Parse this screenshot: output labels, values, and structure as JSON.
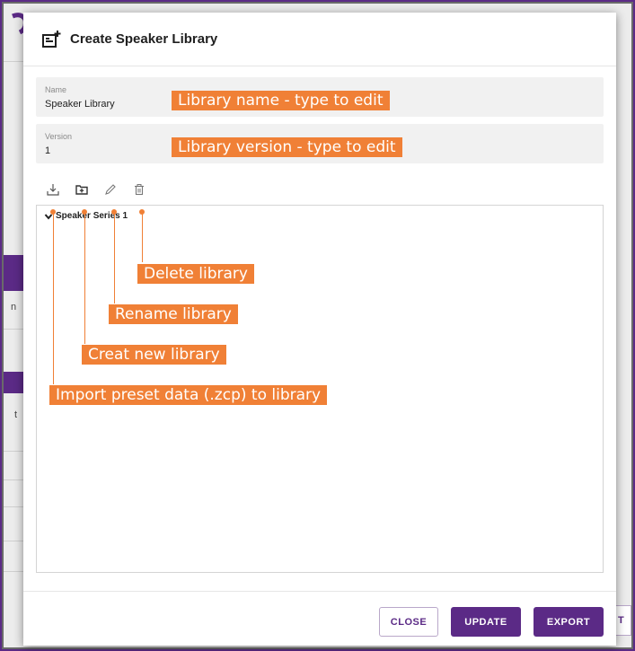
{
  "modal": {
    "title": "Create Speaker Library",
    "icon": "add-library-icon"
  },
  "fields": {
    "name": {
      "label": "Name",
      "value": "Speaker Library"
    },
    "version": {
      "label": "Version",
      "value": "1"
    }
  },
  "toolbar": {
    "items": [
      {
        "icon": "import-icon"
      },
      {
        "icon": "new-folder-icon"
      },
      {
        "icon": "pencil-icon"
      },
      {
        "icon": "trash-icon"
      }
    ]
  },
  "tree": {
    "items": [
      {
        "label": "Speaker Series 1",
        "expanded": true
      }
    ]
  },
  "footer": {
    "close_label": "CLOSE",
    "update_label": "UPDATE",
    "export_label": "EXPORT"
  },
  "annotations": {
    "name_hint": "Library name - type to edit",
    "version_hint": "Library version - type to edit",
    "delete": "Delete library",
    "rename": "Rename library",
    "create": "Creat new library",
    "import": "Import preset data (.zcp) to library"
  },
  "background": {
    "peek_button": "T"
  },
  "colors": {
    "accent": "#5b2a86",
    "annotation": "#f08036"
  }
}
